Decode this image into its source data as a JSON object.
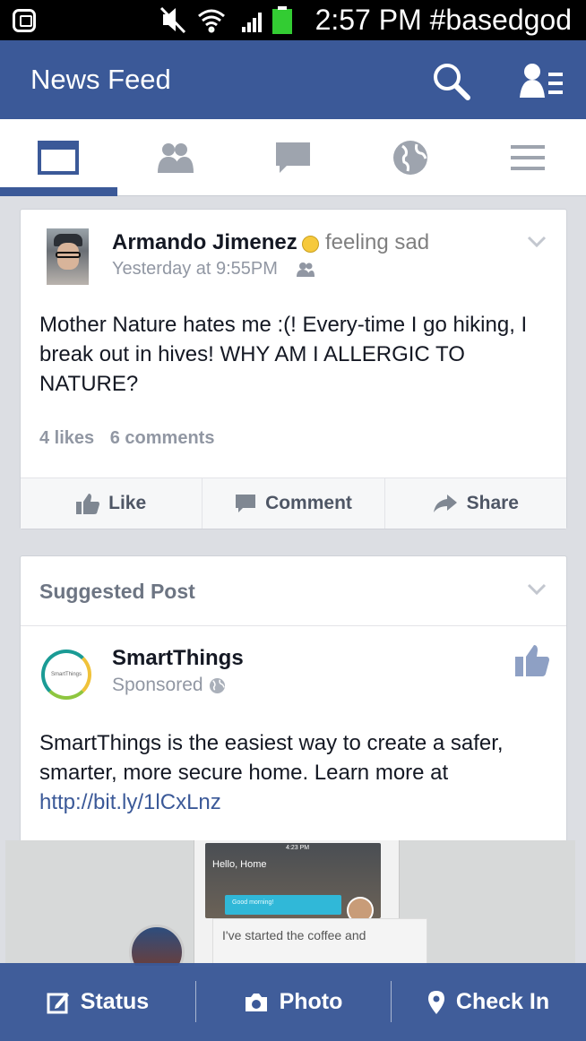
{
  "status_bar": {
    "time": "2:57 PM #basedgod"
  },
  "header": {
    "title": "News Feed"
  },
  "tabs": [
    "news-feed",
    "friend-requests",
    "messages",
    "notifications",
    "more"
  ],
  "post": {
    "author": "Armando Jimenez",
    "feeling": "feeling sad",
    "timestamp": "Yesterday at 9:55PM",
    "text": "Mother Nature hates me :(! Every-time I go hiking, I break out in hives! WHY AM I ALLERGIC TO NATURE?",
    "likes": "4 likes",
    "comments": "6 comments",
    "actions": {
      "like": "Like",
      "comment": "Comment",
      "share": "Share"
    }
  },
  "suggested": {
    "heading": "Suggested Post",
    "brand": "SmartThings",
    "brand_logo_text": "SmartThings",
    "sponsored": "Sponsored",
    "text": "SmartThings is the easiest way to create a safer, smarter, more secure home. Learn more at ",
    "link": "http://bit.ly/1lCxLnz",
    "image": {
      "phone_time": "4:23 PM",
      "hello": "Hello, Home",
      "button": "Good morning!",
      "bubble": "I've started the coffee and"
    }
  },
  "bottom_bar": {
    "status": "Status",
    "photo": "Photo",
    "checkin": "Check In"
  },
  "colors": {
    "brand_blue": "#3b5998",
    "background": "#dcdee3",
    "text_dark": "#141823",
    "text_muted": "#9197a3"
  }
}
